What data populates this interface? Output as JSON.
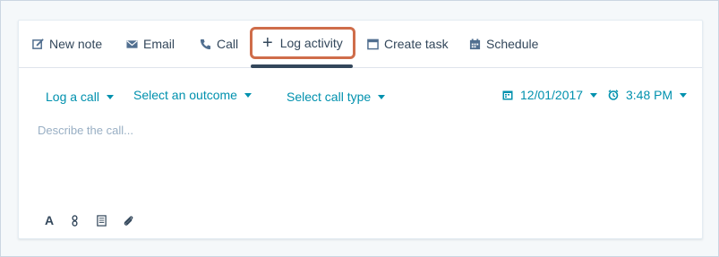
{
  "tabs": [
    {
      "label": "New note",
      "icon": "edit-icon"
    },
    {
      "label": "Email",
      "icon": "envelope-icon"
    },
    {
      "label": "Call",
      "icon": "phone-icon"
    },
    {
      "label": "Log activity",
      "icon": "plus-icon",
      "active": true
    },
    {
      "label": "Create task",
      "icon": "task-icon"
    },
    {
      "label": "Schedule",
      "icon": "calendar-icon"
    }
  ],
  "filters": {
    "activity_type": "Log a call",
    "outcome": "Select an outcome",
    "call_type": "Select call type",
    "date": "12/01/2017",
    "time": "3:48 PM"
  },
  "editor": {
    "placeholder": "Describe the call...",
    "value": ""
  },
  "format_toolbar": {
    "text_style_label": "A",
    "items": [
      "text-style-icon",
      "link-icon",
      "snippet-icon",
      "attachment-icon"
    ]
  },
  "colors": {
    "accent": "#0091ae",
    "text": "#33475b",
    "highlight": "#cf6d4a",
    "placeholder": "#99afc4"
  }
}
